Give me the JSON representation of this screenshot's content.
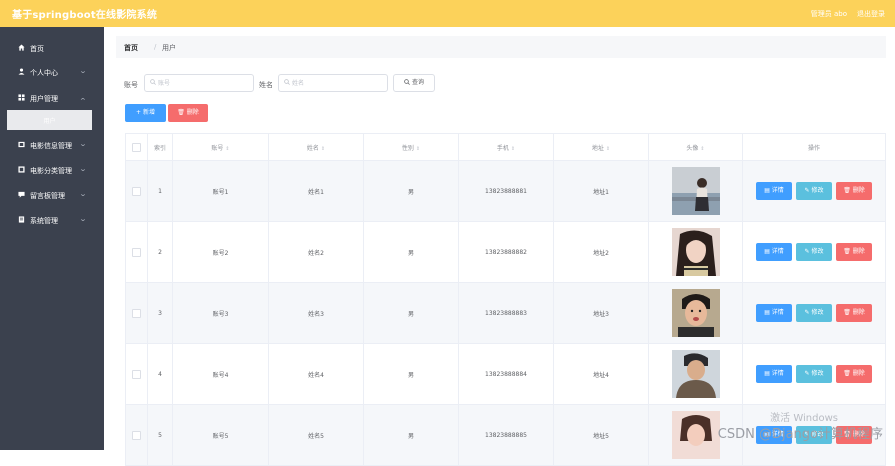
{
  "app": {
    "title": "基于springboot在线影院系统",
    "user_text": "管理员 abo",
    "logout": "退出登录"
  },
  "sidebar": {
    "items": [
      {
        "label": "首页",
        "icon": "home-icon"
      },
      {
        "label": "个人中心",
        "icon": "user-icon"
      },
      {
        "label": "用户管理",
        "icon": "grid-icon"
      },
      {
        "label": "电影信息管理",
        "icon": "film-icon"
      },
      {
        "label": "电影分类管理",
        "icon": "category-icon"
      },
      {
        "label": "留言板管理",
        "icon": "message-icon"
      },
      {
        "label": "系统管理",
        "icon": "settings-icon"
      }
    ],
    "subitem": "用户"
  },
  "breadcrumb": {
    "home": "首页",
    "sep": "/",
    "current": "用户"
  },
  "search": {
    "account_label": "账号",
    "account_placeholder": "账号",
    "name_label": "姓名",
    "name_placeholder": "姓名",
    "query_button": "查询"
  },
  "actions": {
    "add": "新增",
    "delete": "删除"
  },
  "table": {
    "headers": [
      "索引",
      "账号",
      "姓名",
      "性别",
      "手机",
      "地址",
      "头像",
      "操作"
    ],
    "rows": [
      {
        "index": "1",
        "account": "账号1",
        "name": "姓名1",
        "gender": "男",
        "phone": "13823888881",
        "address": "地址1"
      },
      {
        "index": "2",
        "account": "账号2",
        "name": "姓名2",
        "gender": "男",
        "phone": "13823888882",
        "address": "地址2"
      },
      {
        "index": "3",
        "account": "账号3",
        "name": "姓名3",
        "gender": "男",
        "phone": "13823888883",
        "address": "地址3"
      },
      {
        "index": "4",
        "account": "账号4",
        "name": "姓名4",
        "gender": "男",
        "phone": "13823888884",
        "address": "地址4"
      },
      {
        "index": "5",
        "account": "账号5",
        "name": "姓名5",
        "gender": "男",
        "phone": "13823888885",
        "address": "地址5"
      }
    ],
    "op_labels": {
      "detail": "详情",
      "edit": "修改",
      "delete": "删除"
    }
  },
  "watermark": {
    "activate": "激活 Windows",
    "csdn": "CSDN @Django计算机程序"
  },
  "colors": {
    "topbar": "#fcd25a",
    "sidebar": "#3b414e",
    "primary": "#409eff",
    "danger": "#f56c6c",
    "info": "#5bc0de"
  }
}
